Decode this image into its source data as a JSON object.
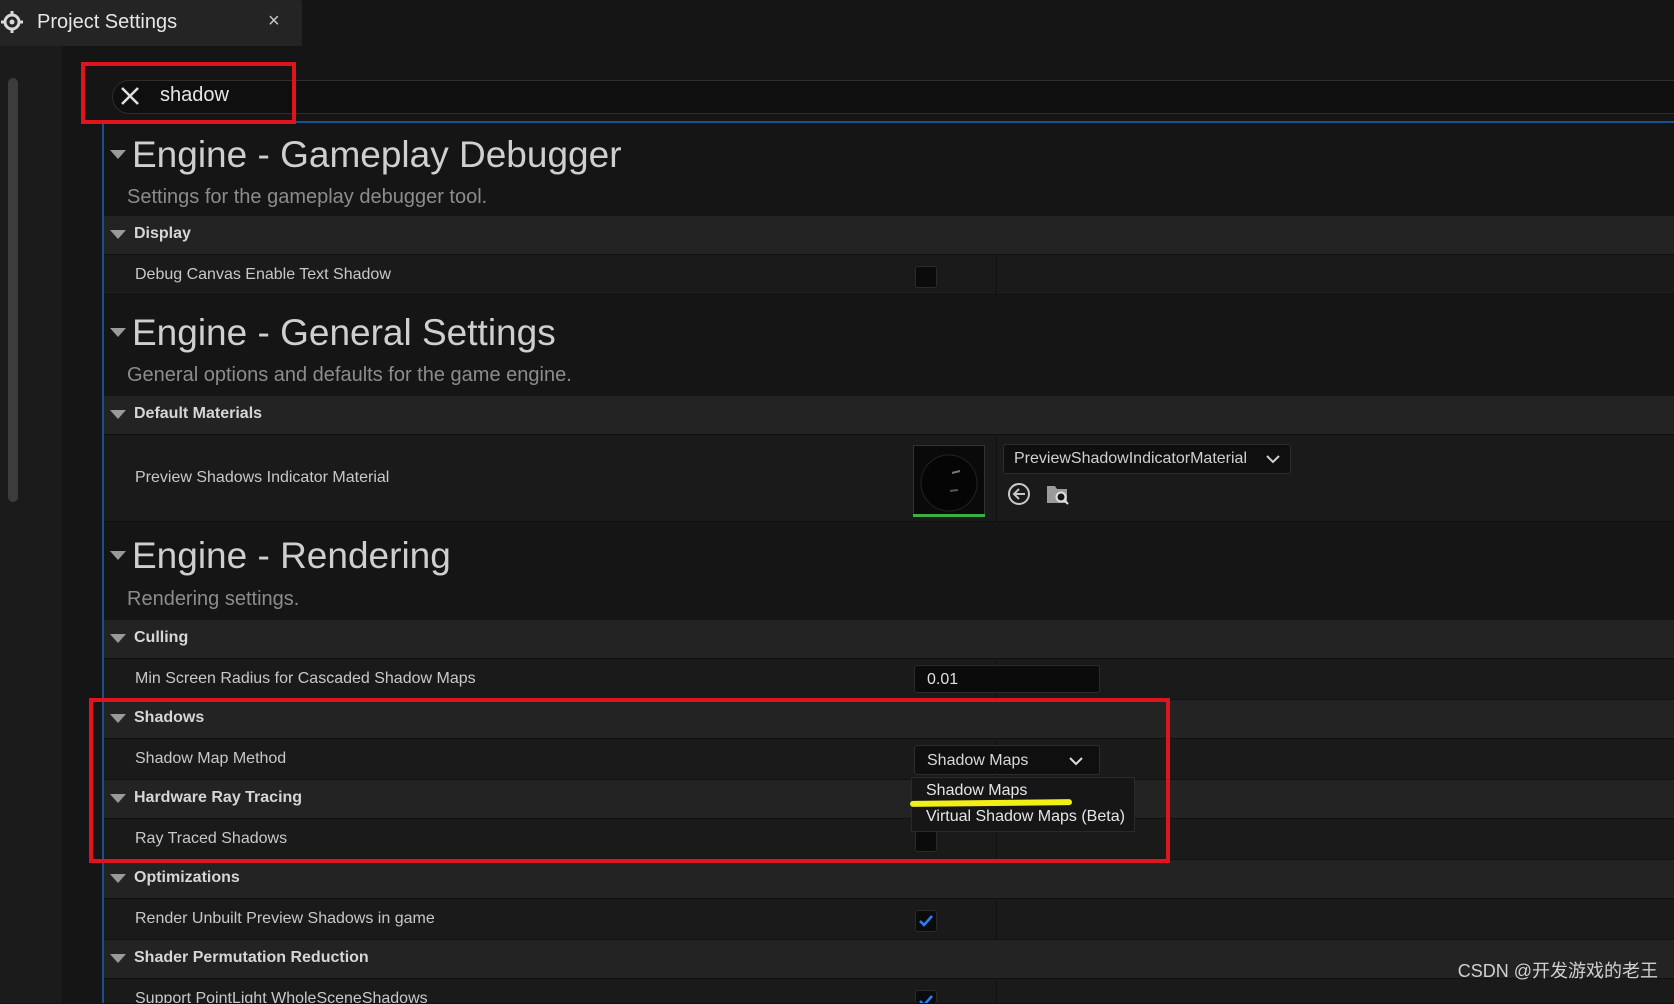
{
  "tab": {
    "title": "Project Settings",
    "close": "×"
  },
  "search": {
    "value": "shadow"
  },
  "sections": [
    {
      "title": "Engine - Gameplay Debugger",
      "description": "Settings for the gameplay debugger tool.",
      "categories": [
        {
          "label": "Display",
          "rows": [
            {
              "label": "Debug Canvas Enable Text Shadow",
              "type": "checkbox",
              "checked": false
            }
          ]
        }
      ]
    },
    {
      "title": "Engine - General Settings",
      "description": "General options and defaults for the game engine.",
      "categories": [
        {
          "label": "Default Materials",
          "rows": [
            {
              "label": "Preview Shadows Indicator Material",
              "type": "asset",
              "value": "PreviewShadowIndicatorMaterial"
            }
          ]
        }
      ]
    },
    {
      "title": "Engine - Rendering",
      "description": "Rendering settings.",
      "categories": [
        {
          "label": "Culling",
          "rows": [
            {
              "label": "Min Screen Radius for Cascaded Shadow Maps",
              "type": "number",
              "value": "0.01"
            }
          ]
        },
        {
          "label": "Shadows",
          "rows": [
            {
              "label": "Shadow Map Method",
              "type": "select",
              "value": "Shadow Maps",
              "options": [
                "Shadow Maps",
                "Virtual Shadow Maps (Beta)"
              ]
            }
          ]
        },
        {
          "label": "Hardware Ray Tracing",
          "rows": [
            {
              "label": "Ray Traced Shadows",
              "type": "checkbox",
              "checked": false
            }
          ]
        },
        {
          "label": "Optimizations",
          "rows": [
            {
              "label": "Render Unbuilt Preview Shadows in game",
              "type": "checkbox",
              "checked": true
            }
          ]
        },
        {
          "label": "Shader Permutation Reduction",
          "rows": [
            {
              "label": "Support PointLight WholeSceneShadows",
              "type": "checkbox",
              "checked": true
            }
          ]
        }
      ]
    }
  ],
  "watermark": "CSDN @开发游戏的老王",
  "colors": {
    "background": "#151515",
    "accent_blue": "#1d4f8c",
    "annotation_red": "#e0141c",
    "annotation_yellow": "#f2ef16",
    "check_blue": "#2a7fff"
  },
  "icons": [
    "settings-icon",
    "close-icon",
    "search-clear-icon",
    "collapse-arrow-icon",
    "chevron-down-icon",
    "browse-back-icon",
    "find-in-browser-icon",
    "checkmark-icon"
  ]
}
